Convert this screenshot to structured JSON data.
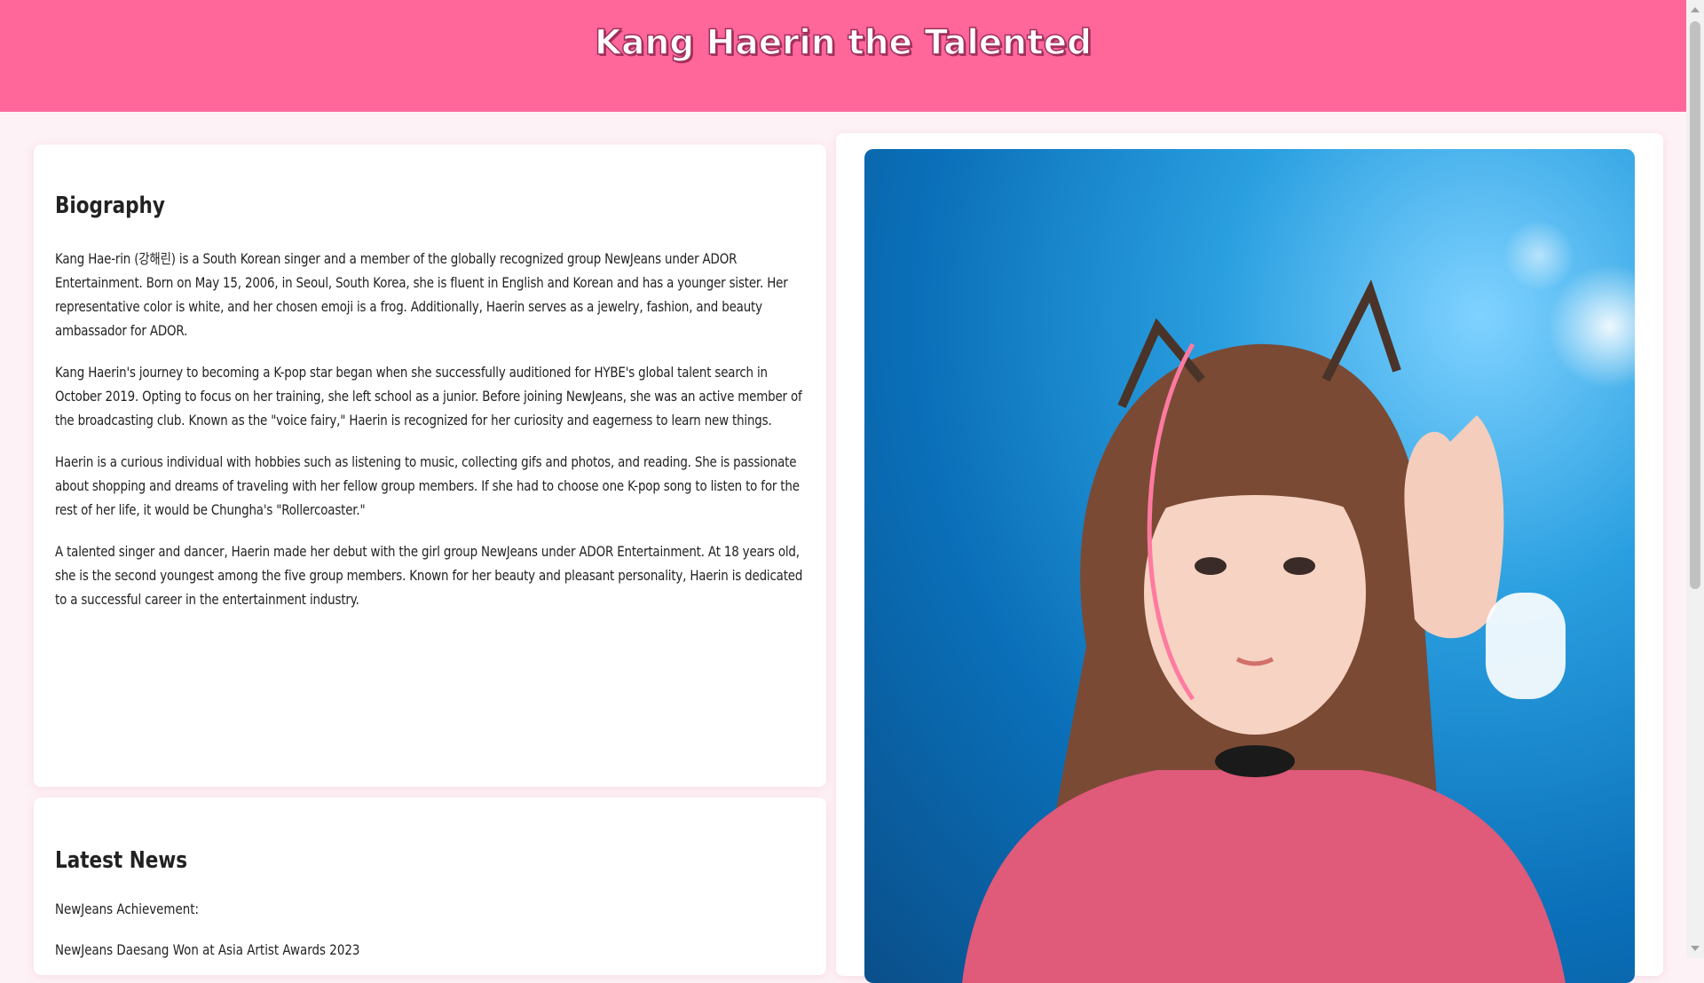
{
  "header": {
    "title": "Kang Haerin the Talented"
  },
  "biography": {
    "heading": "Biography",
    "paragraphs": [
      "Kang Hae-rin (강해린) is a South Korean singer and a member of the globally recognized group NewJeans under ADOR Entertainment. Born on May 15, 2006, in Seoul, South Korea, she is fluent in English and Korean and has a younger sister. Her representative color is white, and her chosen emoji is a frog. Additionally, Haerin serves as a jewelry, fashion, and beauty ambassador for ADOR.",
      "Kang Haerin's journey to becoming a K-pop star began when she successfully auditioned for HYBE's global talent search in October 2019. Opting to focus on her training, she left school as a junior. Before joining NewJeans, she was an active member of the broadcasting club. Known as the \"voice fairy,\" Haerin is recognized for her curiosity and eagerness to learn new things.",
      "Haerin is a curious individual with hobbies such as listening to music, collecting gifs and photos, and reading. She is passionate about shopping and dreams of traveling with her fellow group members. If she had to choose one K-pop song to listen to for the rest of her life, it would be Chungha's \"Rollercoaster.\"",
      "A talented singer and dancer, Haerin made her debut with the girl group NewJeans under ADOR Entertainment. At 18 years old, she is the second youngest among the five group members. Known for her beauty and pleasant personality, Haerin is dedicated to a successful career in the entertainment industry."
    ]
  },
  "news": {
    "heading": "Latest News",
    "label": "NewJeans Achievement:",
    "item": "NewJeans Daesang Won at Asia Artist Awards 2023"
  },
  "photo": {
    "icon": "photo-image"
  },
  "colors": {
    "header": "#ff6699",
    "background": "#fdf2f6",
    "card": "#ffffff"
  }
}
